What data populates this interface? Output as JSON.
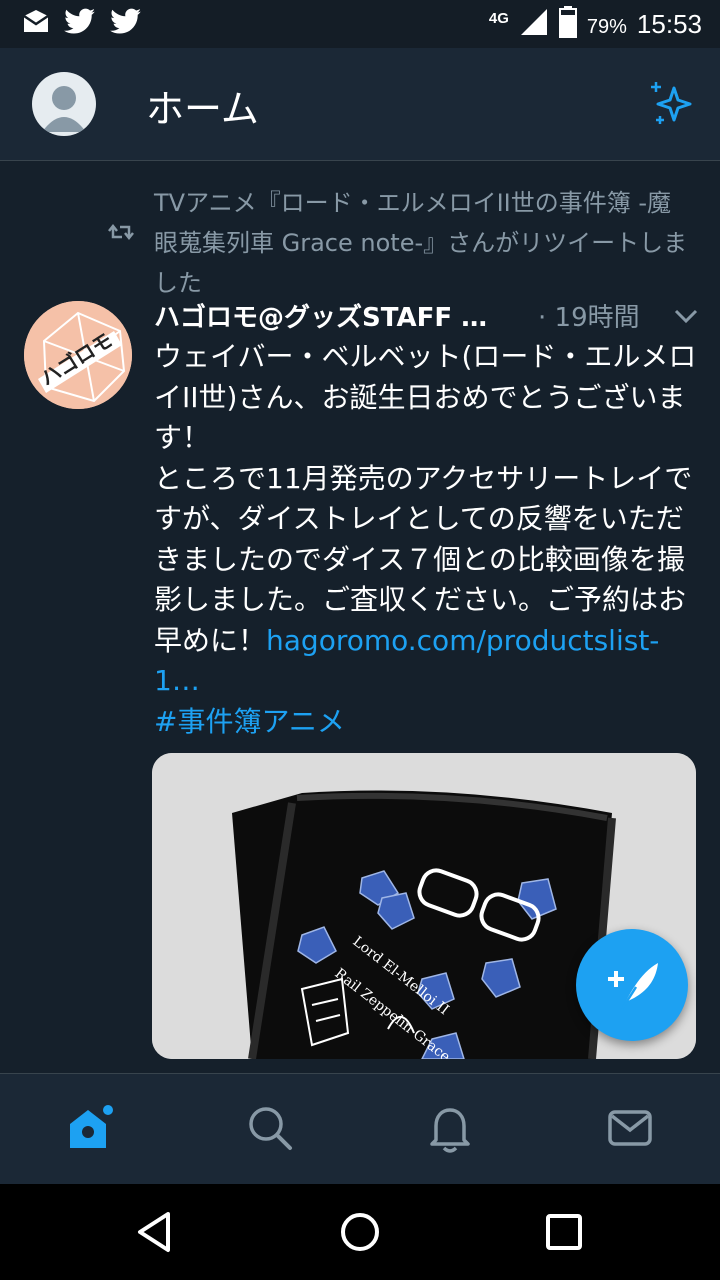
{
  "status_bar": {
    "network": "4G",
    "battery": "79%",
    "time": "15:53",
    "icons": [
      "mail-notification-icon",
      "twitter-icon",
      "twitter-icon",
      "signal-icon",
      "battery-icon"
    ]
  },
  "header": {
    "title": "ホーム",
    "icons": [
      "profile-avatar",
      "sparkle-icon"
    ]
  },
  "tweet": {
    "retweet_context": "TVアニメ『ロード・エルメロイII世の事件簿 -魔眼蒐集列車 Grace note-』さんがリツイートしました",
    "author": "ハゴロモ@グッズSTAFF …",
    "timestamp": "· 19時間",
    "body_lines": [
      "ウェイバー・ベルベット(ロード・エルメロイII世)さん、お誕生日おめでとうございます！",
      "ところで11月発売のアクセサリートレイですが、ダイストレイとしての反響をいただきましたのでダイス７個との比較画像を撮影しました。ご査収ください。ご予約はお早めに！"
    ],
    "link": "hagoromo.com/productslist-1…",
    "hashtag": "#事件簿アニメ"
  },
  "tab_bar": {
    "tabs": [
      "home-icon",
      "search-icon",
      "notifications-icon",
      "messages-icon"
    ],
    "active": "home-icon"
  },
  "colors": {
    "background": "#15202b",
    "header": "#1b2836",
    "accent": "#1da1f2",
    "muted": "#8899a6"
  }
}
